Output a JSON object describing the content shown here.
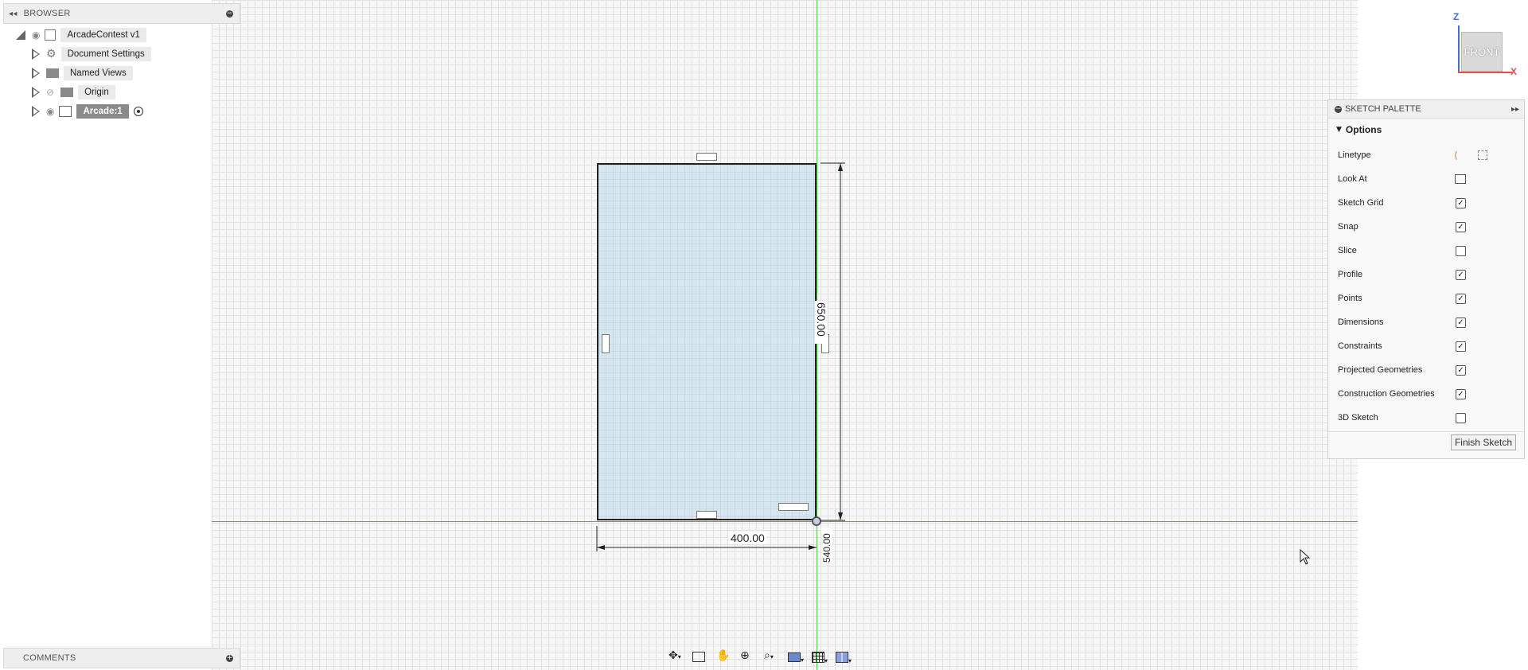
{
  "browser": {
    "title": "BROWSER",
    "root": "ArcadeContest v1",
    "items": [
      {
        "label": "Document Settings"
      },
      {
        "label": "Named Views"
      },
      {
        "label": "Origin"
      },
      {
        "label": "Arcade:1"
      }
    ]
  },
  "comments": {
    "title": "COMMENTS"
  },
  "view_cube": {
    "face": "FRONT",
    "axis_z": "Z",
    "axis_x": "X"
  },
  "sketch": {
    "dim_width": "400.00",
    "dim_height": "650.00",
    "dim_small": "540.00"
  },
  "palette": {
    "title": "SKETCH PALETTE",
    "section": "Options",
    "rows": [
      {
        "label": "Linetype"
      },
      {
        "label": "Look At"
      },
      {
        "label": "Sketch Grid",
        "checked": true
      },
      {
        "label": "Snap",
        "checked": true
      },
      {
        "label": "Slice",
        "checked": false
      },
      {
        "label": "Profile",
        "checked": true
      },
      {
        "label": "Points",
        "checked": true
      },
      {
        "label": "Dimensions",
        "checked": true
      },
      {
        "label": "Constraints",
        "checked": true
      },
      {
        "label": "Projected Geometries",
        "checked": true
      },
      {
        "label": "Construction Geometries",
        "checked": true
      },
      {
        "label": "3D Sketch",
        "checked": false
      }
    ],
    "finish_label": "Finish Sketch"
  },
  "colors": {
    "x_axis": "#e04040",
    "z_axis": "#40c040",
    "profile_fill": "#aed0e6"
  }
}
